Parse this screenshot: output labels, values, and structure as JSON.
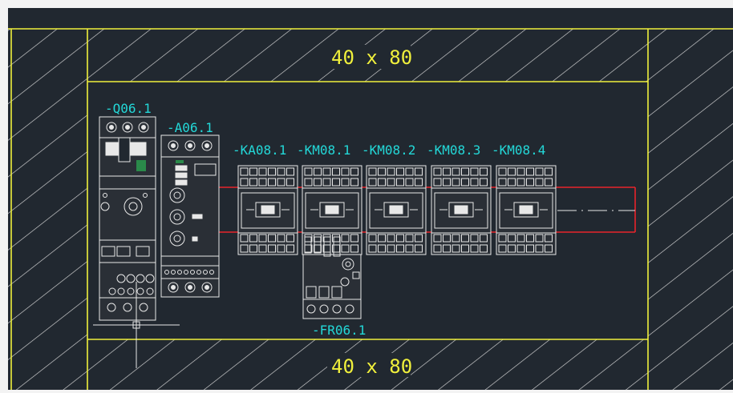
{
  "drawing": {
    "duct_labels": {
      "top": "40 x 80",
      "bottom": "40 x 80"
    },
    "component_tags": {
      "q": "-Q06.1",
      "a": "-A06.1",
      "ka": "-KA08.1",
      "km1": "-KM08.1",
      "km2": "-KM08.2",
      "km3": "-KM08.3",
      "km4": "-KM08.4",
      "fr": "-FR06.1"
    },
    "colors": {
      "background": "#212830",
      "frame": "#f0f03c",
      "tag_text": "#23d8d8",
      "component": "#e8e8e8",
      "rail": "#e8242a",
      "hatch": "#d8d8d8"
    }
  }
}
